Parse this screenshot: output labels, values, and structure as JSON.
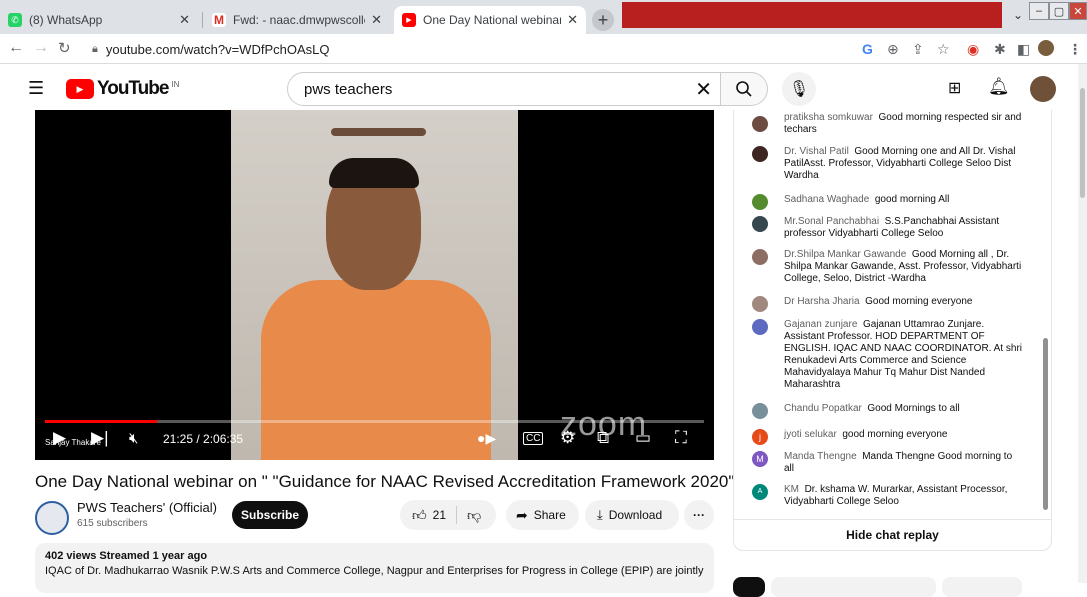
{
  "browser": {
    "tabs": [
      {
        "label": "(8) WhatsApp",
        "active": false
      },
      {
        "label": "Fwd: - naac.dmwpwscollege@gn",
        "active": false
      },
      {
        "label": "One Day National webinar on \" \"",
        "active": true
      }
    ],
    "new_tab": "+",
    "url": "youtube.com/watch?v=WDfPchOAsLQ"
  },
  "youtube": {
    "logo_text": "YouTube",
    "region": "IN",
    "search_value": "pws teachers"
  },
  "player": {
    "time": "21:25 / 2:06:35",
    "watermark": "zoom",
    "speaker_label": "Sanjay Thakare",
    "progress_fraction": 0.17
  },
  "video": {
    "title": "One Day National webinar on \" \"Guidance for NAAC Revised Accreditation Framework 2020\"",
    "channel_name": "PWS Teachers' (Official)",
    "subscribers": "615 subscribers",
    "subscribe_label": "Subscribe",
    "likes": "21",
    "share_label": "Share",
    "download_label": "Download",
    "more_label": "···",
    "meta": "402 views  Streamed 1 year ago",
    "description": "IQAC of Dr. Madhukarrao Wasnik P.W.S Arts and Commerce College, Nagpur and Enterprises for Progress in College (EPIP) are jointly"
  },
  "chat": {
    "messages": [
      {
        "author": "pratiksha somkuwar",
        "text": "Good morning respected sir and techars",
        "color": "#6d4c41"
      },
      {
        "author": "Dr. Vishal Patil",
        "text": "Good Morning one and All Dr. Vishal PatilAsst. Professor, Vidyabharti College Seloo Dist Wardha",
        "color": "#3e2723"
      },
      {
        "author": "Sadhana Waghade",
        "text": "good morning All",
        "color": "#558b2f"
      },
      {
        "author": "Mr.Sonal Panchabhai",
        "text": "S.S.Panchabhai Assistant professor Vidyabharti College Seloo",
        "color": "#37474f"
      },
      {
        "author": "Dr.Shilpa Mankar Gawande",
        "text": "Good Morning all , Dr. Shilpa Mankar Gawande, Asst. Professor, Vidyabharti College, Seloo, District -Wardha",
        "color": "#8d6e63"
      },
      {
        "author": "Dr Harsha Jharia",
        "text": "Good morning everyone",
        "color": "#a1887f"
      },
      {
        "author": "Gajanan zunjare",
        "text": "Gajanan Uttamrao Zunjare. Assistant Professor. HOD DEPARTMENT OF ENGLISH. IQAC AND NAAC COORDINATOR. At shri Renukadevi Arts Commerce and Science Mahavidyalaya Mahur Tq Mahur Dist Nanded Maharashtra",
        "color": "#5c6bc0"
      },
      {
        "author": "Chandu Popatkar",
        "text": "Good Mornings to all",
        "color": "#78909c"
      },
      {
        "author": "jyoti selukar",
        "text": "good morning everyone",
        "color": "#e64a19",
        "initial": "j"
      },
      {
        "author": "Manda Thengne",
        "text": "Manda Thengne Good morning to all",
        "color": "#7e57c2",
        "initial": "M"
      },
      {
        "author": "KM",
        "text": "Dr. kshama W. Murarkar, Assistant Processor, Vidyabharti College Seloo",
        "color": "#00897b",
        "initial": "A"
      }
    ],
    "hide_label": "Hide chat replay"
  }
}
